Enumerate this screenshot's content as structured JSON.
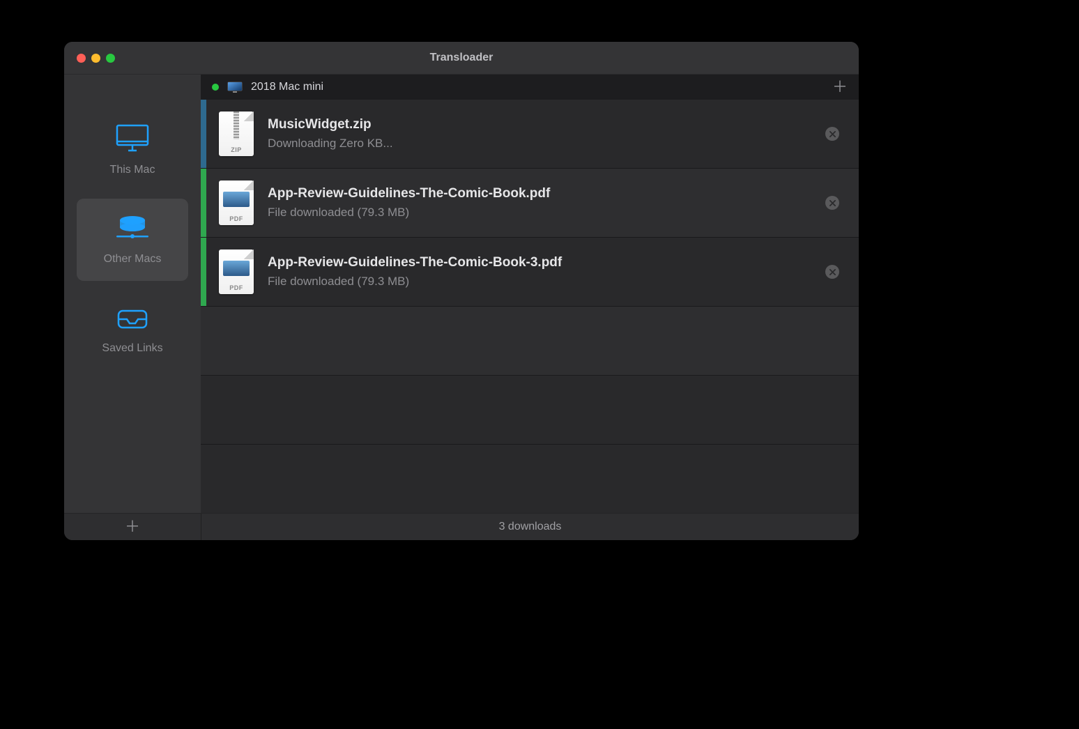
{
  "title": "Transloader",
  "sidebar": {
    "items": [
      {
        "id": "this-mac",
        "label": "This Mac",
        "icon": "imac-icon",
        "selected": false
      },
      {
        "id": "other-macs",
        "label": "Other Macs",
        "icon": "drive-stack-icon",
        "selected": true
      },
      {
        "id": "saved-links",
        "label": "Saved Links",
        "icon": "inbox-icon",
        "selected": false
      }
    ]
  },
  "device": {
    "status": "online",
    "status_color": "#28c840",
    "name": "2018 Mac mini"
  },
  "downloads": [
    {
      "name": "MusicWidget.zip",
      "status": "Downloading Zero KB...",
      "type": "zip",
      "ext_label": "ZIP",
      "stripe": "blue"
    },
    {
      "name": "App-Review-Guidelines-The-Comic-Book.pdf",
      "status": "File downloaded (79.3 MB)",
      "type": "pdf",
      "ext_label": "PDF",
      "stripe": "green"
    },
    {
      "name": "App-Review-Guidelines-The-Comic-Book-3.pdf",
      "status": "File downloaded (79.3 MB)",
      "type": "pdf",
      "ext_label": "PDF",
      "stripe": "green"
    }
  ],
  "footer": {
    "status": "3 downloads"
  },
  "colors": {
    "accent": "#0a84ff",
    "green": "#28c840"
  }
}
